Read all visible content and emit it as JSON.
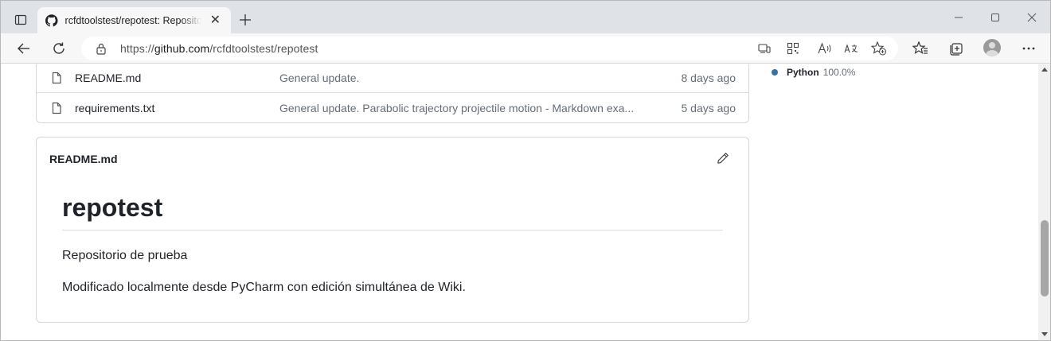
{
  "browser": {
    "tab_title": "rcfdtoolstest/repotest: Repository",
    "url_prefix": "https://",
    "url_host": "github.com",
    "url_path": "/rcfdtoolstest/repotest"
  },
  "files": [
    {
      "name": "README.md",
      "message": "General update.",
      "age": "8 days ago"
    },
    {
      "name": "requirements.txt",
      "message": "General update. Parabolic trajectory projectile motion - Markdown exa...",
      "age": "5 days ago"
    }
  ],
  "readme": {
    "filename": "README.md",
    "heading": "repotest",
    "paragraph1": "Repositorio de prueba",
    "paragraph2": "Modificado localmente desde PyCharm con edición simultánea de Wiki."
  },
  "languages": [
    {
      "name": "Python",
      "percent": "100.0%",
      "color": "#3572A5"
    }
  ],
  "icons": {
    "tab_favicon": "github-icon",
    "file": "file-icon",
    "edit": "pencil-icon"
  }
}
